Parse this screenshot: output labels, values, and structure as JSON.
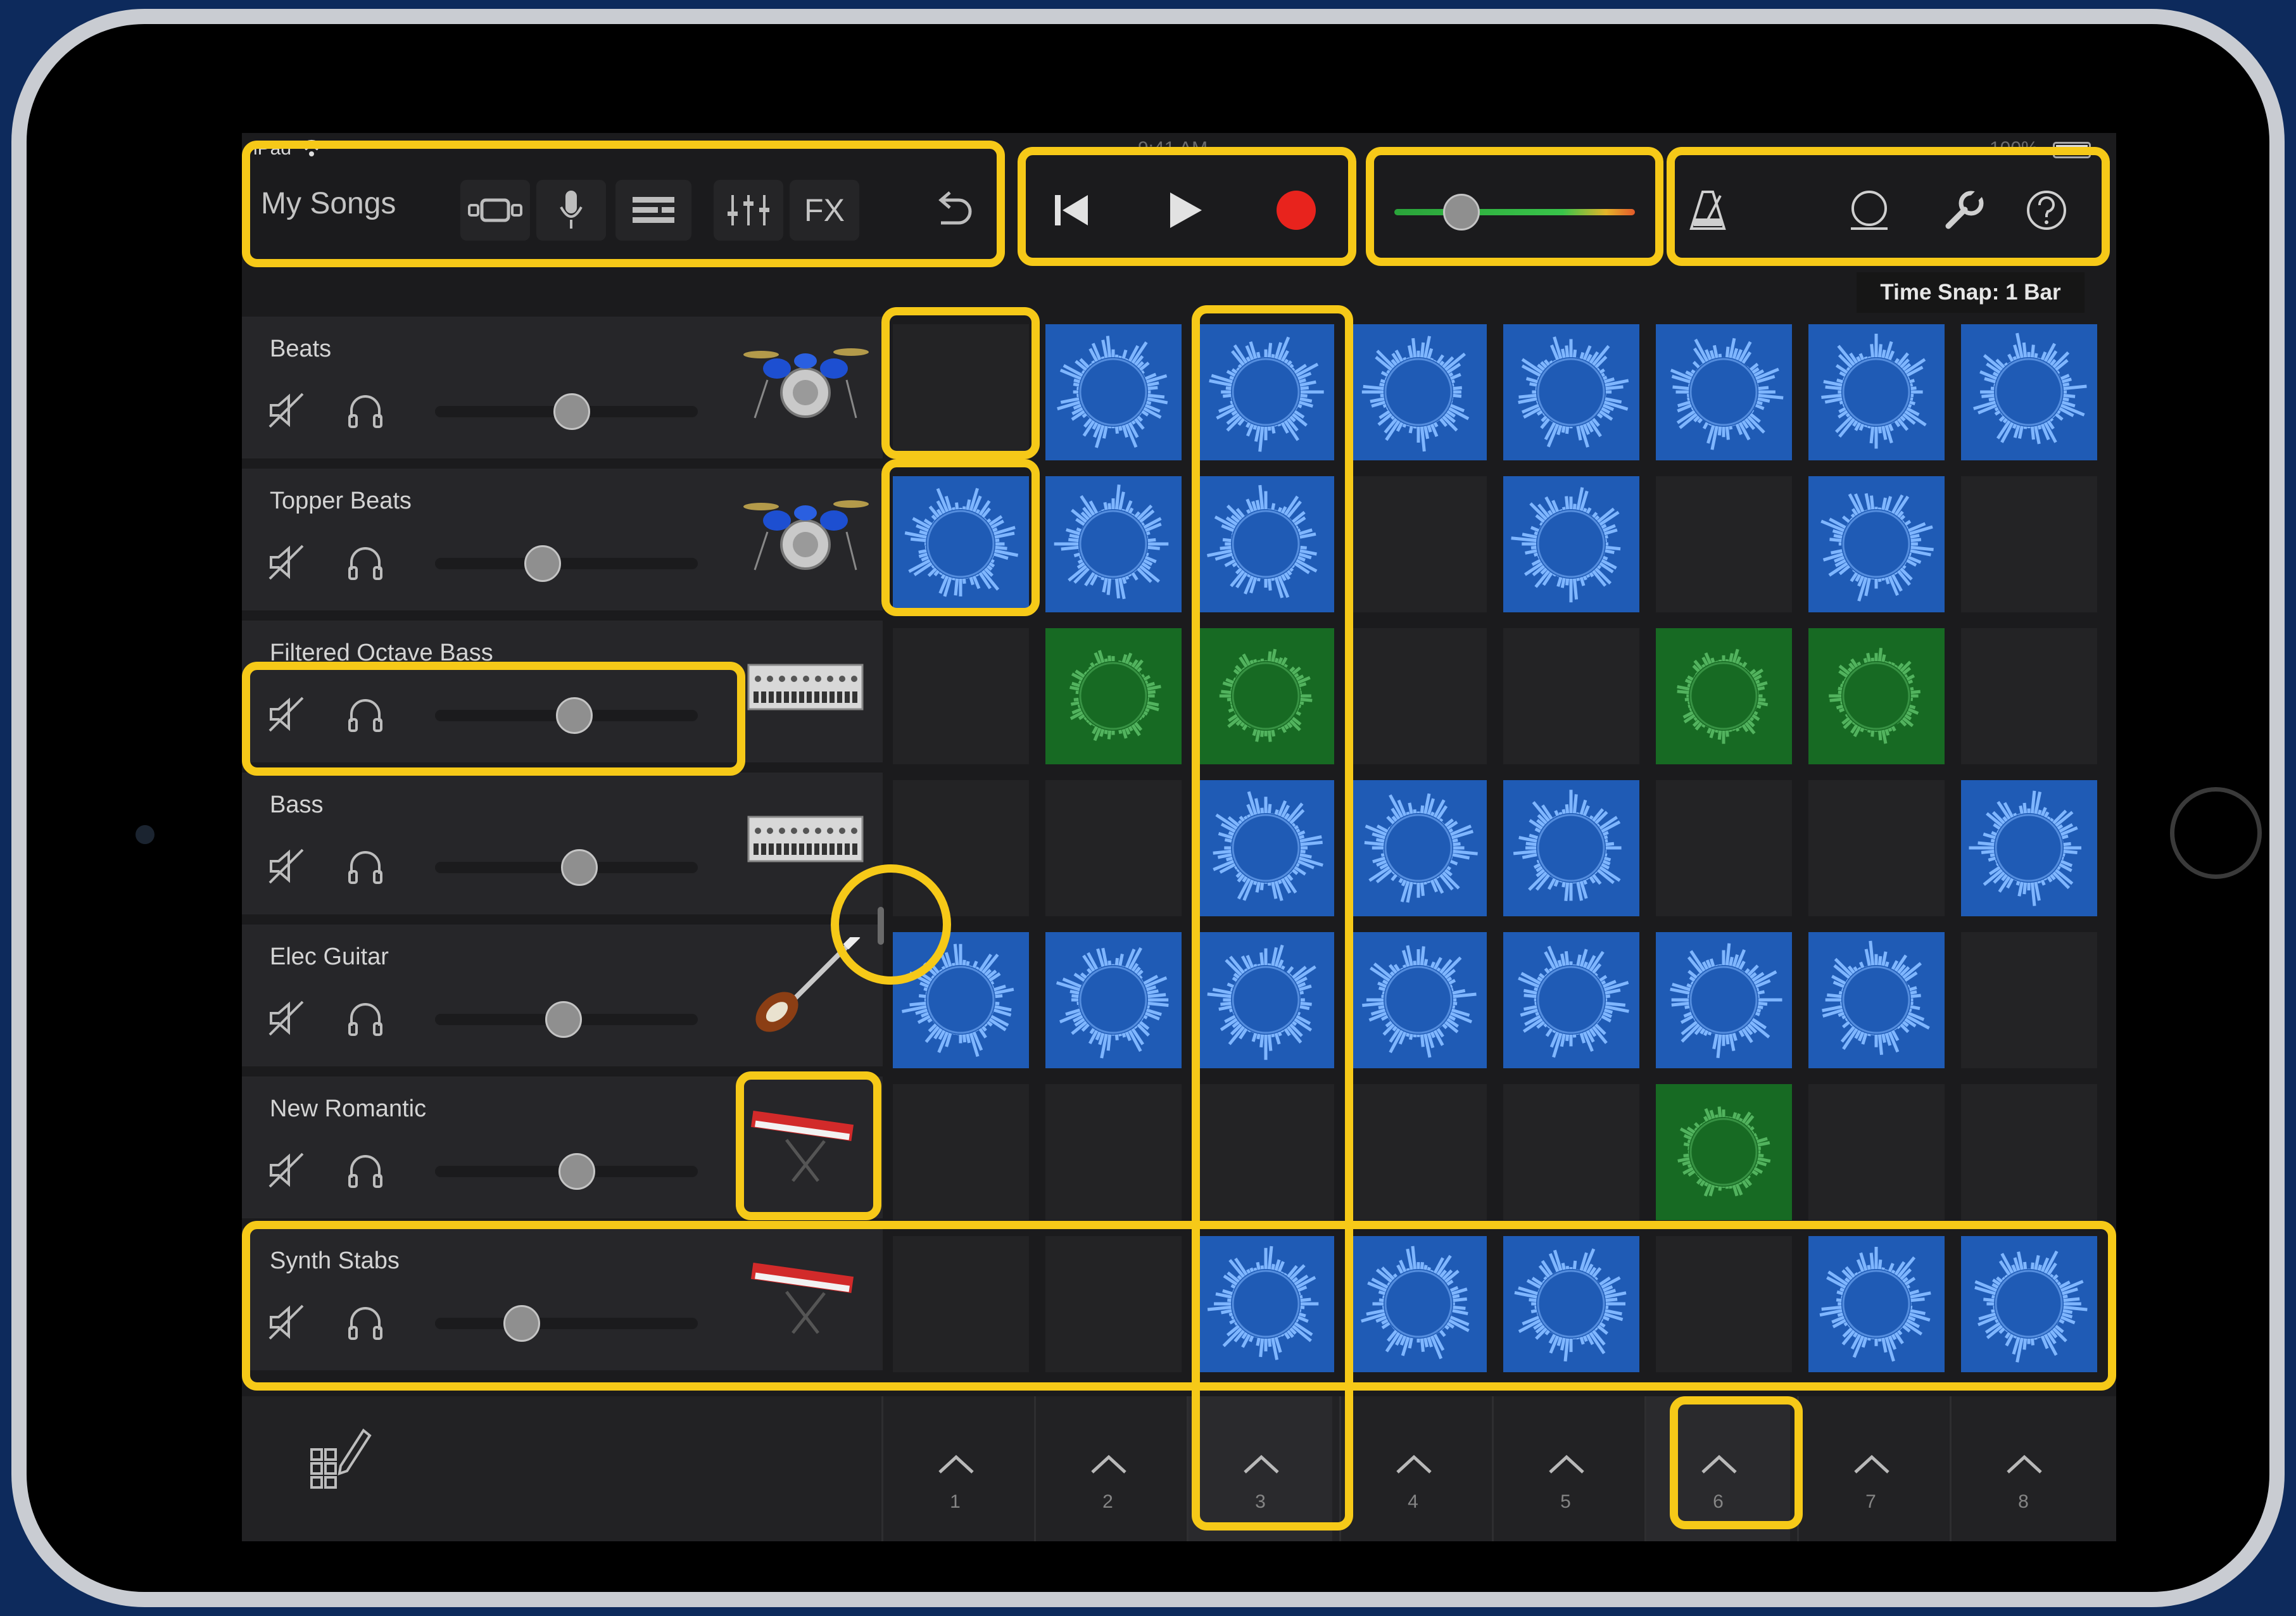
{
  "status_bar": {
    "device": "iPad",
    "time": "9:41 AM",
    "battery": "100%"
  },
  "toolbar": {
    "my_songs": "My Songs",
    "fx": "FX",
    "time_snap": "Time Snap: 1 Bar",
    "master_volume_level": 0.28
  },
  "tracks": [
    {
      "name": "Beats",
      "instrument": "drum-kit-icon",
      "volume": 0.52
    },
    {
      "name": "Topper Beats",
      "instrument": "drum-kit-icon",
      "volume": 0.41
    },
    {
      "name": "Filtered Octave Bass",
      "instrument": "synth-module-icon",
      "volume": 0.53
    },
    {
      "name": "Bass",
      "instrument": "synth-module-icon",
      "volume": 0.55
    },
    {
      "name": "Elec Guitar",
      "instrument": "electric-guitar-icon",
      "volume": 0.49
    },
    {
      "name": "New Romantic",
      "instrument": "red-keyboard-icon",
      "volume": 0.54
    },
    {
      "name": "Synth Stabs",
      "instrument": "red-keyboard-icon",
      "volume": 0.33
    }
  ],
  "grid": {
    "rows": [
      [
        "empty",
        "blue",
        "blue",
        "blue",
        "blue",
        "blue",
        "blue",
        "blue"
      ],
      [
        "blue",
        "blue",
        "blue",
        "empty",
        "blue",
        "empty",
        "blue",
        "empty"
      ],
      [
        "empty",
        "green",
        "green",
        "empty",
        "empty",
        "green",
        "green",
        "empty"
      ],
      [
        "empty",
        "empty",
        "blue",
        "blue",
        "blue",
        "empty",
        "empty",
        "blue"
      ],
      [
        "blue",
        "blue",
        "blue",
        "blue",
        "blue",
        "blue",
        "blue",
        "empty"
      ],
      [
        "empty",
        "empty",
        "empty",
        "empty",
        "empty",
        "green",
        "empty",
        "empty"
      ],
      [
        "empty",
        "empty",
        "blue",
        "blue",
        "blue",
        "empty",
        "blue",
        "blue"
      ]
    ]
  },
  "columns": [
    "1",
    "2",
    "3",
    "4",
    "5",
    "6",
    "7",
    "8"
  ],
  "colors": {
    "highlight": "#f6c918",
    "cell_blue": "#1f5bb5",
    "cell_green": "#176a23",
    "record": "#e8231d",
    "background": "#0d2a5c"
  }
}
